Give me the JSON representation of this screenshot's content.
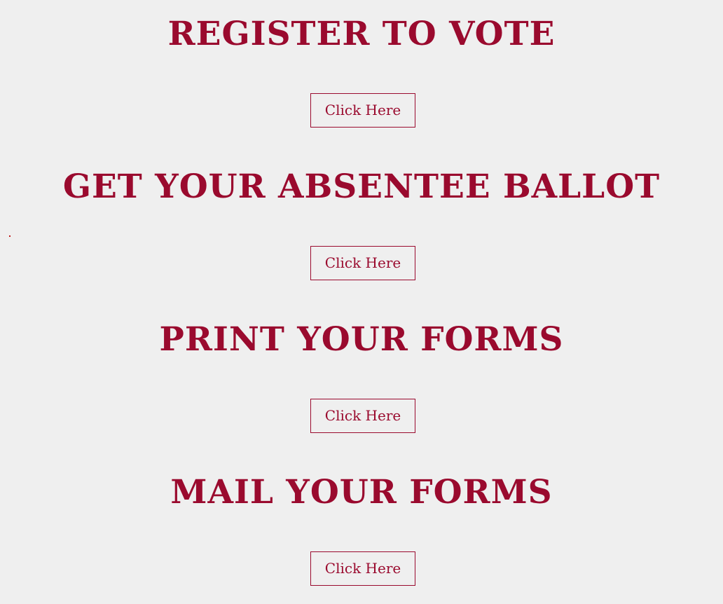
{
  "colors": {
    "background": "#efefef",
    "accent": "#9a0a2e"
  },
  "sections": [
    {
      "heading": "REGISTER TO VOTE",
      "button_label": "Click Here"
    },
    {
      "heading": "GET YOUR ABSENTEE BALLOT",
      "button_label": "Click Here"
    },
    {
      "heading": "PRINT YOUR FORMS",
      "button_label": "Click Here"
    },
    {
      "heading": "MAIL YOUR FORMS",
      "button_label": "Click Here"
    }
  ]
}
